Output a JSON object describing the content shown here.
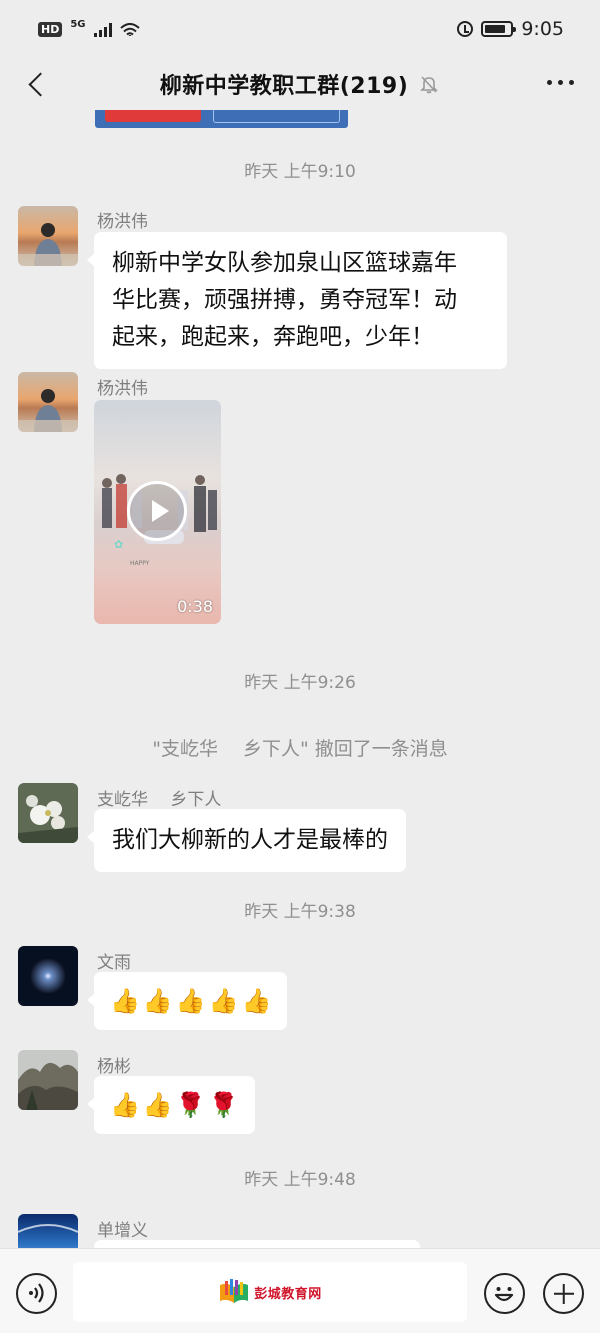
{
  "status_bar": {
    "hd": "HD",
    "network": "5G",
    "time": "9:05"
  },
  "header": {
    "title": "柳新中学教职工群(219)",
    "mute_icon": "bell-muted-icon",
    "more_icon": "more-icon",
    "back_icon": "back-icon"
  },
  "messages": {
    "ts1": "昨天 上午9:10",
    "m1": {
      "sender": "杨洪伟",
      "lines": [
        "柳新中学女队参加泉山区篮球嘉年",
        "华比赛，顽强拼搏，勇夺冠军！动",
        "起来，跑起来，奔跑吧，少年！"
      ]
    },
    "m2": {
      "sender": "杨洪伟",
      "video_duration": "0:38",
      "video_caption": "HAPPY"
    },
    "ts2": "昨天 上午9:26",
    "recall_notice": "\"支屹华　 乡下人\" 撤回了一条消息",
    "m3": {
      "sender": "支屹华　 乡下人",
      "text": "我们大柳新的人才是最棒的"
    },
    "ts3": "昨天 上午9:38",
    "m4": {
      "sender": "文雨",
      "emojis": [
        "👍",
        "👍",
        "👍",
        "👍",
        "👍"
      ]
    },
    "m5": {
      "sender": "杨彬",
      "emojis": [
        "👍",
        "👍",
        "🌹",
        "🌹"
      ]
    },
    "ts4": "昨天 上午9:48",
    "m6": {
      "sender": "单增义"
    }
  },
  "input_bar": {
    "watermark_text": "彭城教育网",
    "voice_icon": "voice-icon",
    "emoji_icon": "emoji-icon",
    "plus_icon": "plus-icon"
  },
  "colors": {
    "background": "#ededed",
    "bubble": "#ffffff",
    "watermark": "#d0152b"
  }
}
